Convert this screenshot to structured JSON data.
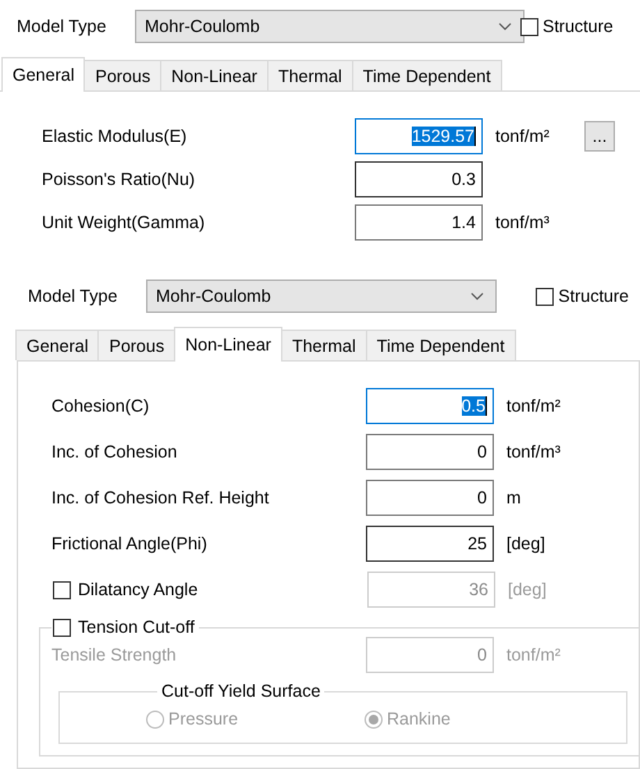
{
  "panels": [
    {
      "model_type": {
        "label": "Model Type",
        "value": "Mohr-Coulomb"
      },
      "structure": {
        "label": "Structure",
        "checked": false
      },
      "tabs": [
        {
          "label": "General",
          "selected": true
        },
        {
          "label": "Porous",
          "selected": false
        },
        {
          "label": "Non-Linear",
          "selected": false
        },
        {
          "label": "Thermal",
          "selected": false
        },
        {
          "label": "Time Dependent",
          "selected": false
        }
      ],
      "rows": [
        {
          "kind": "input",
          "label": "Elastic Modulus(E)",
          "value": "1529.57",
          "unit": "tonf/m²",
          "focused": true,
          "hovered": false,
          "disabled": false,
          "button": "..."
        },
        {
          "kind": "input",
          "label": "Poisson's Ratio(Nu)",
          "value": "0.3",
          "focused": false,
          "hovered": true,
          "disabled": false
        },
        {
          "kind": "input",
          "label": "Unit Weight(Gamma)",
          "value": "1.4",
          "unit": "tonf/m³",
          "focused": false,
          "hovered": false,
          "disabled": false
        }
      ]
    },
    {
      "model_type": {
        "label": "Model Type",
        "value": "Mohr-Coulomb"
      },
      "structure": {
        "label": "Structure",
        "checked": false
      },
      "tabs": [
        {
          "label": "General",
          "selected": false
        },
        {
          "label": "Porous",
          "selected": false
        },
        {
          "label": "Non-Linear",
          "selected": true
        },
        {
          "label": "Thermal",
          "selected": false
        },
        {
          "label": "Time Dependent",
          "selected": false
        }
      ],
      "rows": [
        {
          "kind": "input",
          "label": "Cohesion(C)",
          "value": "0.5",
          "unit": "tonf/m²",
          "focused": true,
          "hovered": false,
          "disabled": false
        },
        {
          "kind": "input",
          "label": "Inc. of Cohesion",
          "value": "0",
          "unit": "tonf/m³",
          "focused": false,
          "hovered": false,
          "disabled": false
        },
        {
          "kind": "input",
          "label": "Inc. of Cohesion Ref. Height",
          "value": "0",
          "unit": "m",
          "focused": false,
          "hovered": false,
          "disabled": false
        },
        {
          "kind": "input",
          "label": "Frictional Angle(Phi)",
          "value": "25",
          "unit": "[deg]",
          "focused": false,
          "hovered": true,
          "disabled": false
        },
        {
          "kind": "check_input",
          "label": "Dilatancy Angle",
          "checked": false,
          "value": "36",
          "unit": "[deg]",
          "disabled": true
        },
        {
          "kind": "group",
          "label": "Tension Cut-off",
          "checked": false,
          "rows": [
            {
              "kind": "input",
              "label": "Tensile Strength",
              "value": "0",
              "unit": "tonf/m²",
              "disabled": true
            }
          ],
          "subgroup": {
            "title": "Cut-off Yield Surface",
            "disabled": true,
            "options": [
              {
                "label": "Pressure",
                "selected": false
              },
              {
                "label": "Rankine",
                "selected": true
              }
            ]
          }
        }
      ]
    }
  ]
}
